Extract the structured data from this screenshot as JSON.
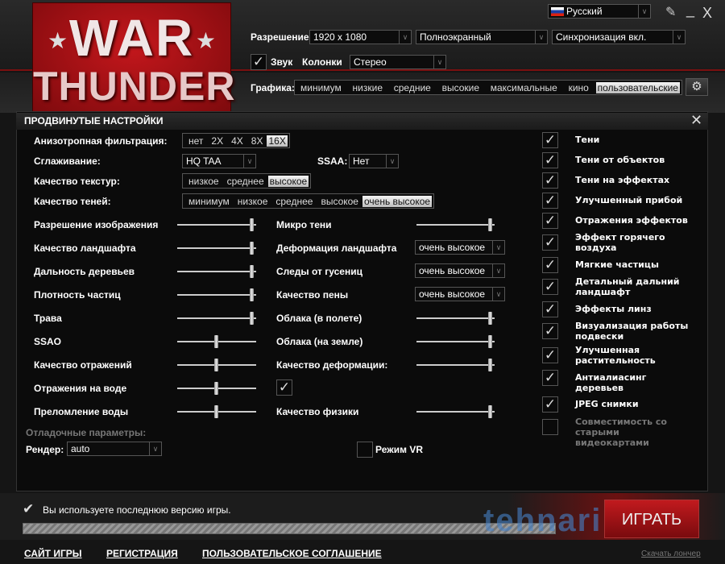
{
  "logo": {
    "line1": "WAR",
    "line2": "THUNDER"
  },
  "window": {
    "language": "Русский",
    "minimize_label": "_",
    "close_label": "X"
  },
  "top": {
    "resolution_label": "Разрешение",
    "resolution": "1920 x 1080",
    "mode": "Полноэкранный",
    "vsync": "Синхронизация вкл.",
    "sound_label": "Звук",
    "sound_checked": true,
    "speakers_label": "Колонки",
    "speakers": "Стерео",
    "graphics_label": "Графика:",
    "graphics_presets": [
      "минимум",
      "низкие",
      "средние",
      "высокие",
      "максимальные",
      "кино",
      "пользовательские"
    ],
    "graphics_selected": "пользовательские"
  },
  "panel": {
    "title": "ПРОДВИНУТЫЕ НАСТРОЙКИ",
    "aniso_label": "Анизотропная фильтрация:",
    "aniso_options": [
      "нет",
      "2X",
      "4X",
      "8X",
      "16X"
    ],
    "aniso_selected": "16X",
    "aa_label": "Сглаживание:",
    "aa_value": "HQ TAA",
    "ssaa_label": "SSAA:",
    "ssaa_value": "Нет",
    "tex_label": "Качество текстур:",
    "tex_options": [
      "низкое",
      "среднее",
      "высокое"
    ],
    "tex_selected": "высокое",
    "shadow_label": "Качество теней:",
    "shadow_options": [
      "минимум",
      "низкое",
      "среднее",
      "высокое",
      "очень высокое"
    ],
    "shadow_selected": "очень высокое",
    "left_sliders": [
      {
        "label": "Разрешение изображения",
        "value": 1.0
      },
      {
        "label": "Качество ландшафта",
        "value": 1.0
      },
      {
        "label": "Дальность деревьев",
        "value": 1.0
      },
      {
        "label": "Плотность частиц",
        "value": 1.0
      },
      {
        "label": "Трава",
        "value": 1.0
      },
      {
        "label": "SSAO",
        "value": 0.5
      },
      {
        "label": "Качество отражений",
        "value": 0.5
      },
      {
        "label": "Отражения на воде",
        "value": 0.5
      },
      {
        "label": "Преломление воды",
        "value": 0.5
      }
    ],
    "right_controls": [
      {
        "label": "Микро тени",
        "type": "slider",
        "value": 1.0
      },
      {
        "label": "Деформация ландшафта",
        "type": "select",
        "value": "очень высокое"
      },
      {
        "label": "Следы от гусениц",
        "type": "select",
        "value": "очень высокое"
      },
      {
        "label": "Качество пены",
        "type": "select",
        "value": "очень высокое"
      },
      {
        "label": "Облака (в полете)",
        "type": "slider",
        "value": 1.0
      },
      {
        "label": "Облака (на земле)",
        "type": "slider",
        "value": 1.0
      },
      {
        "label": "Качество деформации:",
        "type": "slider",
        "value": 1.0
      },
      {
        "label": "",
        "type": "checkbox",
        "value": true
      },
      {
        "label": "Качество физики",
        "type": "slider",
        "value": 1.0
      }
    ],
    "debug_label": "Отладочные параметры:",
    "render_label": "Рендер:",
    "render_value": "auto",
    "vr_label": "Режим VR",
    "vr_checked": false,
    "checkboxes": [
      {
        "label": "Тени",
        "checked": true
      },
      {
        "label": "Тени от объектов",
        "checked": true
      },
      {
        "label": "Тени на эффектах",
        "checked": true
      },
      {
        "label": "Улучшенный прибой",
        "checked": true
      },
      {
        "label": "Отражения эффектов",
        "checked": true
      },
      {
        "label": "Эффект горячего воздуха",
        "checked": true
      },
      {
        "label": "Мягкие частицы",
        "checked": true
      },
      {
        "label": "Детальный дальний ландшафт",
        "checked": true
      },
      {
        "label": "Эффекты линз",
        "checked": true
      },
      {
        "label": "Визуализация работы подвески",
        "checked": true
      },
      {
        "label": "Улучшенная растительность",
        "checked": true
      },
      {
        "label": "Антиалиасинг деревьев",
        "checked": true
      },
      {
        "label": "JPEG снимки",
        "checked": true
      },
      {
        "label": "Совместимость со старыми видеокартами",
        "checked": false
      }
    ]
  },
  "bottom": {
    "status": "Вы используете последнюю версию игры.",
    "progress": 1.0,
    "play_label": "ИГРАТЬ",
    "watermark": "tehnari.ru",
    "links": [
      "САЙТ ИГРЫ",
      "РЕГИСТРАЦИЯ",
      "ПОЛЬЗОВАТЕЛЬСКОЕ СОГЛАШЕНИЕ"
    ],
    "launcher_link": "Скачать лончер"
  }
}
